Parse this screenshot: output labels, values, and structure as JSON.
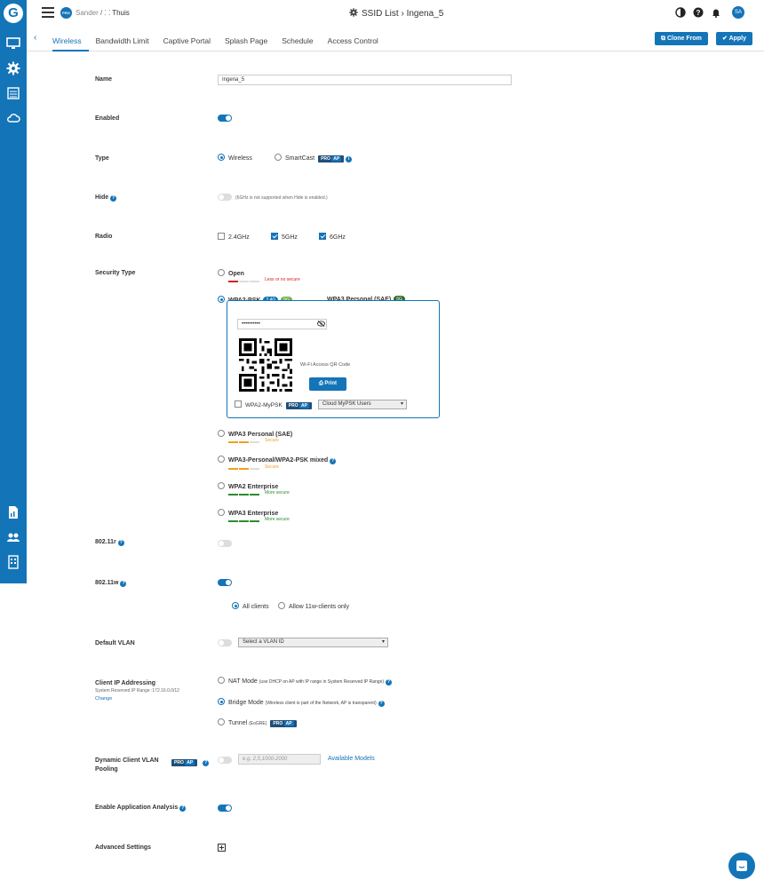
{
  "sidebar": {
    "logo": "G",
    "icons": [
      "monitor-icon",
      "gear-icon",
      "list-icon",
      "cloud-icon",
      "report-icon",
      "users-icon",
      "building-icon"
    ]
  },
  "topbar": {
    "org": "Sander",
    "site": "Thuis",
    "separator": "/",
    "title": "SSID List › Ingena_5",
    "avatar": "SA",
    "pro_badge": "PRO"
  },
  "tabs": [
    "Wireless",
    "Bandwidth Limit",
    "Captive Portal",
    "Splash Page",
    "Schedule",
    "Access Control"
  ],
  "actions": {
    "clone": "Clone From",
    "apply": "Apply"
  },
  "form": {
    "name_label": "Name",
    "name_value": "Ingena_5",
    "enabled_label": "Enabled",
    "type_label": "Type",
    "type_wireless": "Wireless",
    "type_smartcast": "SmartCast",
    "hide_label": "Hide",
    "hide_note": "(6GHz is not supported when Hide is enabled.)",
    "radio_label": "Radio",
    "radio_24": "2.4GHz",
    "radio_5": "5GHz",
    "radio_6": "6GHz",
    "security_label": "Security Type",
    "sec_open": "Open",
    "sec_open_note": "Less or no secure",
    "sec_wpa2psk": "WPA2-PSK",
    "pill_24": "2.4G",
    "pill_5": "5G",
    "pill_6": "6G",
    "sec_secure_note": "Secure",
    "sec_wpa3_sae_side": "WPA3 Personal (SAE)",
    "password_mask": "••••••••••",
    "qr_label": "Wi-Fi Access QR Code",
    "print": "Print",
    "mypsk_label": "WPA2-MyPSK",
    "mypsk_select": "Cloud MyPSK Users",
    "sec_wpa3_sae": "WPA3 Personal (SAE)",
    "sec_wpa3_mixed": "WPA3-Personal/WPA2-PSK mixed",
    "sec_wpa2_ent": "WPA2 Enterprise",
    "sec_wpa3_ent": "WPA3 Enterprise",
    "more_secure_note": "More secure",
    "r80211r_label": "802.11r",
    "r80211w_label": "802.11w",
    "w_all": "All clients",
    "w_allow": "Allow 11w-clients only",
    "vlan_label": "Default VLAN",
    "vlan_select": "Select a VLAN ID",
    "client_ip_label": "Client IP Addressing",
    "reserved_range": "System Reserved IP Range :172.16.0.0/12",
    "change": "Change",
    "nat_mode": "NAT Mode",
    "nat_note": "(use DHCP on AP with IP range in System Reserved IP Range)",
    "bridge_mode": "Bridge Mode",
    "bridge_note": "(Wireless client is part of the Network, AP is transparent)",
    "tunnel": "Tunnel",
    "tunnel_note": "(EoGRE)",
    "dyn_vlan_label_1": "Dynamic Client VLAN",
    "dyn_vlan_label_2": "Pooling",
    "dyn_vlan_placeholder": "e.g. 2,5,1000-2000",
    "available_models": "Available Models",
    "app_analysis_label": "Enable Application Analysis",
    "advanced_label": "Advanced Settings",
    "pro_text": "PRO",
    "ap_text": "AP"
  },
  "colors": {
    "accent": "#1474b8",
    "orange": "#f0a020",
    "green": "#2e8b2e",
    "red": "#d32020"
  }
}
